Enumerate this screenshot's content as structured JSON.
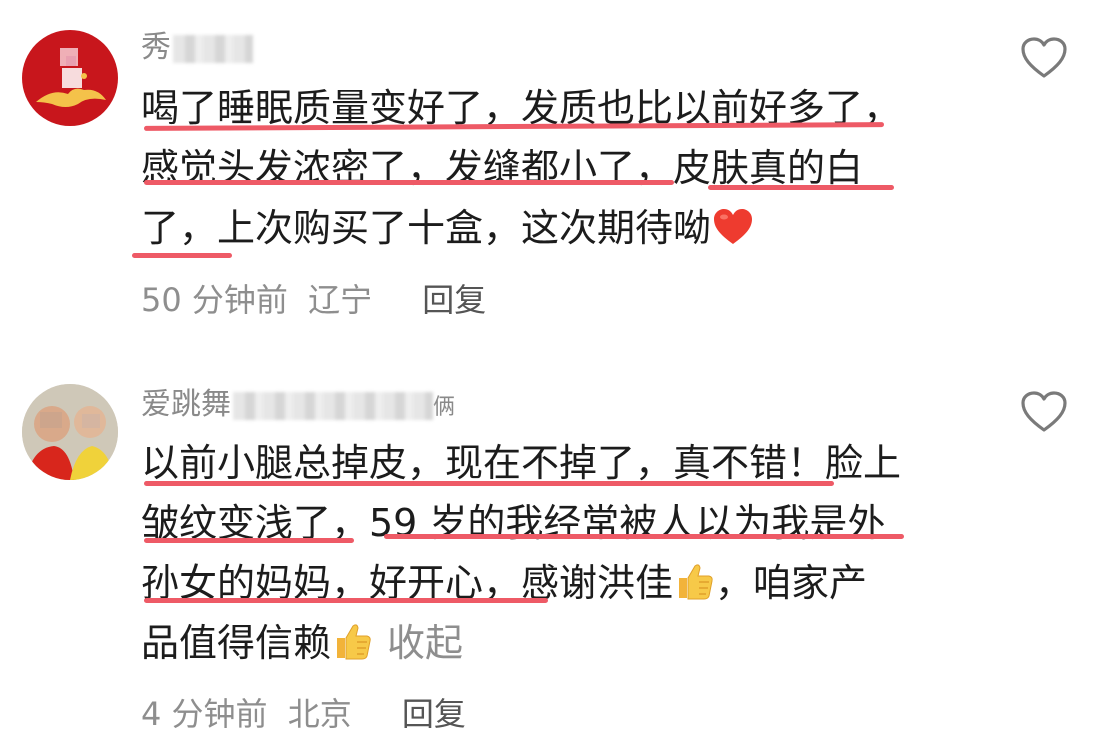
{
  "comments": [
    {
      "username_visible": "秀",
      "lines": [
        "喝了睡眠质量变好了，发质也比以前好多了，",
        "感觉头发浓密了，发缝都小了，皮肤真的白",
        "了，上次购买了十盒，这次期待呦"
      ],
      "time": "50 分钟前",
      "location": "辽宁",
      "reply_label": "回复",
      "emoji": "red-heart-emoji"
    },
    {
      "username_visible": "爱跳舞",
      "username_tail": "俩",
      "lines": [
        "以前小腿总掉皮，现在不掉了，真不错！脸上",
        "皱纹变浅了，59 岁的我经常被人以为我是外",
        "孙女的妈妈，好开心，感谢洪佳",
        "，咱家产"
      ],
      "line4": "品值得信赖",
      "collapse_label": "收起",
      "time": "4 分钟前",
      "location": "北京",
      "reply_label": "回复",
      "emoji": "thumbs-up-emoji"
    }
  ],
  "colors": {
    "underline": "#ee5a66",
    "text": "#1c1c1c",
    "meta": "#8e8e8e",
    "username": "#8a8a8a"
  }
}
